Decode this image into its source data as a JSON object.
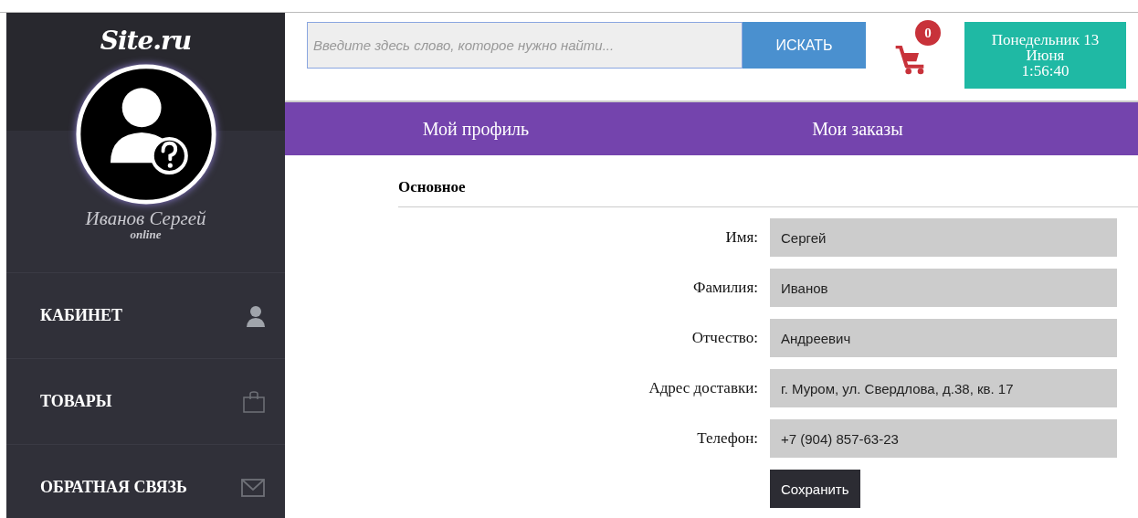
{
  "sidebar": {
    "logo": "Site.ru",
    "user": {
      "name": "Иванов Сергей",
      "status": "online"
    },
    "items": [
      {
        "label": "КАБИНЕТ",
        "kind": "user"
      },
      {
        "label": "ТОВАРЫ",
        "kind": "bag"
      },
      {
        "label": "ОБРАТНАЯ СВЯЗЬ",
        "kind": "mail"
      }
    ]
  },
  "search": {
    "placeholder": "Введите здесь слово, которое нужно найти...",
    "button": "ИСКАТЬ"
  },
  "cart": {
    "count": "0"
  },
  "date": {
    "day": "Понедельник 13",
    "month": "Июня",
    "time": "1:56:40"
  },
  "tabs": [
    {
      "label": "Мой профиль"
    },
    {
      "label": "Мои заказы"
    }
  ],
  "section": {
    "title": "Основное"
  },
  "fields": [
    {
      "label": "Имя:",
      "value": "Сергей"
    },
    {
      "label": "Фамилия:",
      "value": "Иванов"
    },
    {
      "label": "Отчество:",
      "value": "Андреевич"
    },
    {
      "label": "Адрес доставки:",
      "value": "г. Муром, ул. Свердлова, д.38, кв. 17"
    },
    {
      "label": "Телефон:",
      "value": "+7 (904) 857-63-23"
    }
  ],
  "save_button": "Сохранить"
}
